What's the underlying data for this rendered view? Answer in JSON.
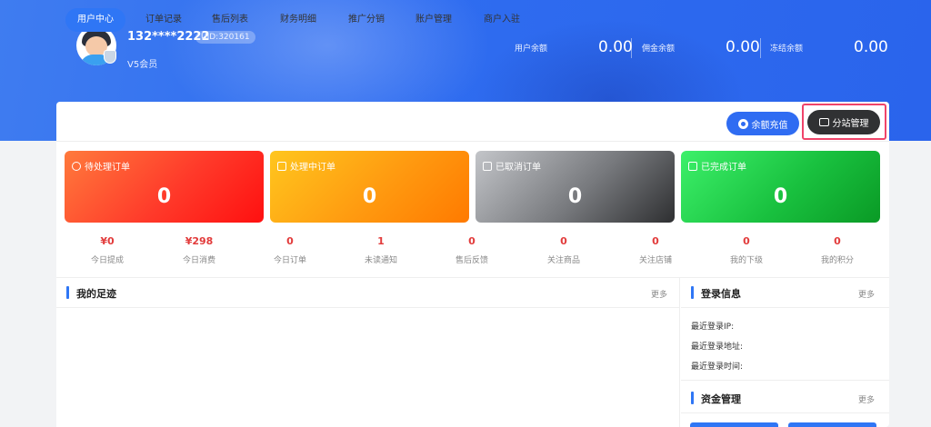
{
  "user": {
    "name": "132****2222",
    "uid": "UID:320161",
    "level": "V5会员"
  },
  "balances": [
    {
      "label": "用户余额",
      "value": "0.00"
    },
    {
      "label": "佣金余额",
      "value": "0.00"
    },
    {
      "label": "冻结余额",
      "value": "0.00"
    }
  ],
  "nav": {
    "items": [
      "用户中心",
      "订单记录",
      "售后列表",
      "财务明细",
      "推广分销",
      "账户管理",
      "商户入驻"
    ],
    "recharge": "余额充值",
    "substation": "分站管理"
  },
  "order_cards": [
    {
      "title": "待处理订单",
      "count": "0"
    },
    {
      "title": "处理中订单",
      "count": "0"
    },
    {
      "title": "已取消订单",
      "count": "0"
    },
    {
      "title": "已完成订单",
      "count": "0"
    }
  ],
  "stats": [
    {
      "value": "¥0",
      "label": "今日提成"
    },
    {
      "value": "¥298",
      "label": "今日消费"
    },
    {
      "value": "0",
      "label": "今日订单"
    },
    {
      "value": "1",
      "label": "未读通知"
    },
    {
      "value": "0",
      "label": "售后反馈"
    },
    {
      "value": "0",
      "label": "关注商品"
    },
    {
      "value": "0",
      "label": "关注店铺"
    },
    {
      "value": "0",
      "label": "我的下级"
    },
    {
      "value": "0",
      "label": "我的积分"
    }
  ],
  "sections": {
    "footprint": {
      "title": "我的足迹",
      "more": "更多"
    },
    "login": {
      "title": "登录信息",
      "more": "更多",
      "ip": "最近登录IP:",
      "address": "最近登录地址:",
      "time": "最近登录时间:"
    },
    "funds": {
      "title": "资金管理",
      "more": "更多"
    }
  },
  "colors": {
    "primary": "#2f76f5",
    "highlight": "#f0446a",
    "stat_value": "#e23b3b"
  }
}
